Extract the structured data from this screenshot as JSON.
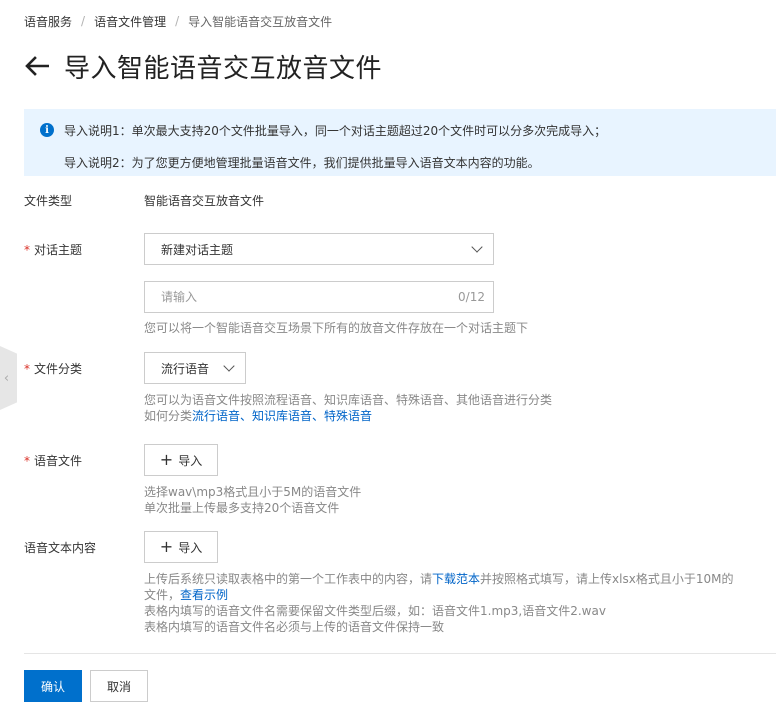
{
  "breadcrumb": {
    "items": [
      "语音服务",
      "语音文件管理",
      "导入智能语音交互放音文件"
    ]
  },
  "header": {
    "title": "导入智能语音交互放音文件"
  },
  "info": {
    "line1": "导入说明1：单次最大支持20个文件批量导入，同一个对话主题超过20个文件时可以分多次完成导入；",
    "line2": "导入说明2：为了您更方便地管理批量语音文件，我们提供批量导入语音文本内容的功能。"
  },
  "form": {
    "file_type": {
      "label": "文件类型",
      "value": "智能语音交互放音文件"
    },
    "topic": {
      "label": "对话主题",
      "required_mark": "*",
      "select_value": "新建对话主题",
      "input_placeholder": "请输入",
      "counter": "0/12",
      "help": "您可以将一个智能语音交互场景下所有的放音文件存放在一个对话主题下"
    },
    "category": {
      "label": "文件分类",
      "required_mark": "*",
      "select_value": "流行语音",
      "help1": "您可以为语音文件按照流程语音、知识库语音、特殊语音、其他语音进行分类",
      "help2_prefix": "如何分类",
      "help2_link": "流行语音、知识库语音、特殊语音"
    },
    "voice_file": {
      "label": "语音文件",
      "required_mark": "*",
      "button_plus": "+",
      "button_label": "导入",
      "help1": "选择wav\\mp3格式且小于5M的语音文件",
      "help2": "单次批量上传最多支持20个语音文件"
    },
    "text_content": {
      "label": "语音文本内容",
      "button_plus": "+",
      "button_label": "导入",
      "help1_prefix": "上传后系统只读取表格中的第一个工作表中的内容，请",
      "help1_link": "下载范本",
      "help1_suffix": "并按照格式填写，请上传xlsx格式且小于10M的",
      "help2_prefix": "文件，",
      "help2_link": "查看示例",
      "help3": "表格内填写的语音文件名需要保留文件类型后缀，如：语音文件1.mp3,语音文件2.wav",
      "help4": "表格内填写的语音文件名必须与上传的语音文件保持一致"
    }
  },
  "footer": {
    "confirm_label": "确认",
    "cancel_label": "取消"
  },
  "colors": {
    "primary": "#0070cc",
    "info_bg": "#e8f4ff",
    "required": "#d93026",
    "link": "#0064c8"
  }
}
